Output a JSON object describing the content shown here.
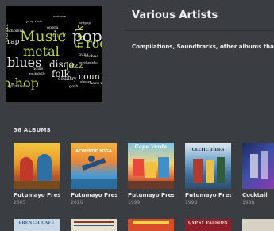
{
  "artist": {
    "name": "Various Artists",
    "description": "Compilations, Soundtracks, other albums that comp",
    "art_words": [
      {
        "t": "Music",
        "c": "#b7d64a"
      },
      {
        "t": "pop",
        "c": "#e8e8e8"
      },
      {
        "t": "metal",
        "c": "#b7d64a"
      },
      {
        "t": "blues",
        "c": "#e8e8e8"
      },
      {
        "t": "soul",
        "c": "#b7d64a"
      },
      {
        "t": "disco",
        "c": "#e8e8e8"
      },
      {
        "t": "folk",
        "c": "#e8e8e8"
      },
      {
        "t": "p-hop",
        "c": "#b7d64a"
      },
      {
        "t": "jazz",
        "c": "#b7d64a"
      },
      {
        "t": "rap",
        "c": "#e8e8e8"
      },
      {
        "t": "funk",
        "c": "#b7d64a"
      },
      {
        "t": "rock",
        "c": "#b7d64a"
      },
      {
        "t": "coun",
        "c": "#e8e8e8"
      },
      {
        "t": "Rock",
        "c": "#b7d64a"
      },
      {
        "t": "country",
        "c": "#e8e8e8"
      },
      {
        "t": "ambient",
        "c": "#e8e8e8"
      },
      {
        "t": "prog-rock",
        "c": "#e8e8e8"
      },
      {
        "t": "motown",
        "c": "#e8e8e8"
      },
      {
        "t": "psychedelic",
        "c": "#e8e8e8"
      },
      {
        "t": "punk",
        "c": "#e8e8e8"
      },
      {
        "t": "rockabilly",
        "c": "#e8e8e8"
      },
      {
        "t": "grindcore",
        "c": "#e8e8e8"
      },
      {
        "t": "noise",
        "c": "#e8e8e8"
      },
      {
        "t": "opera",
        "c": "#e8e8e8"
      },
      {
        "t": "techno",
        "c": "#e8e8e8"
      },
      {
        "t": "hard ro",
        "c": "#e8e8e8"
      },
      {
        "t": "electro",
        "c": "#e8e8e8"
      },
      {
        "t": "britpop",
        "c": "#e8e8e8"
      },
      {
        "t": "goth",
        "c": "#e8e8e8"
      }
    ]
  },
  "albums_section": {
    "heading": "36 ALBUMS"
  },
  "albums": [
    {
      "title": "Putumayo Prese...",
      "year": "2005",
      "cover_text": "",
      "cover_sub": ""
    },
    {
      "title": "Putumayo Prese...",
      "year": "2016",
      "cover_text": "",
      "cover_sub": "ACOUSTIC YOGA"
    },
    {
      "title": "Putumayo Prese...",
      "year": "1999",
      "cover_text": "Cape Verde",
      "cover_sub": ""
    },
    {
      "title": "Putumayo Prese...",
      "year": "1998",
      "cover_text": "",
      "cover_sub": "CELTIC TIDES"
    },
    {
      "title": "Cocktail",
      "year": "1988",
      "cover_text": "",
      "cover_sub": ""
    }
  ],
  "albums_row2": [
    {
      "cover_text": "FRENCH CAFÉ"
    },
    {
      "cover_text": ""
    },
    {
      "cover_text": ""
    },
    {
      "cover_text": "GYPSY PASSION"
    },
    {
      "cover_text": ""
    }
  ]
}
